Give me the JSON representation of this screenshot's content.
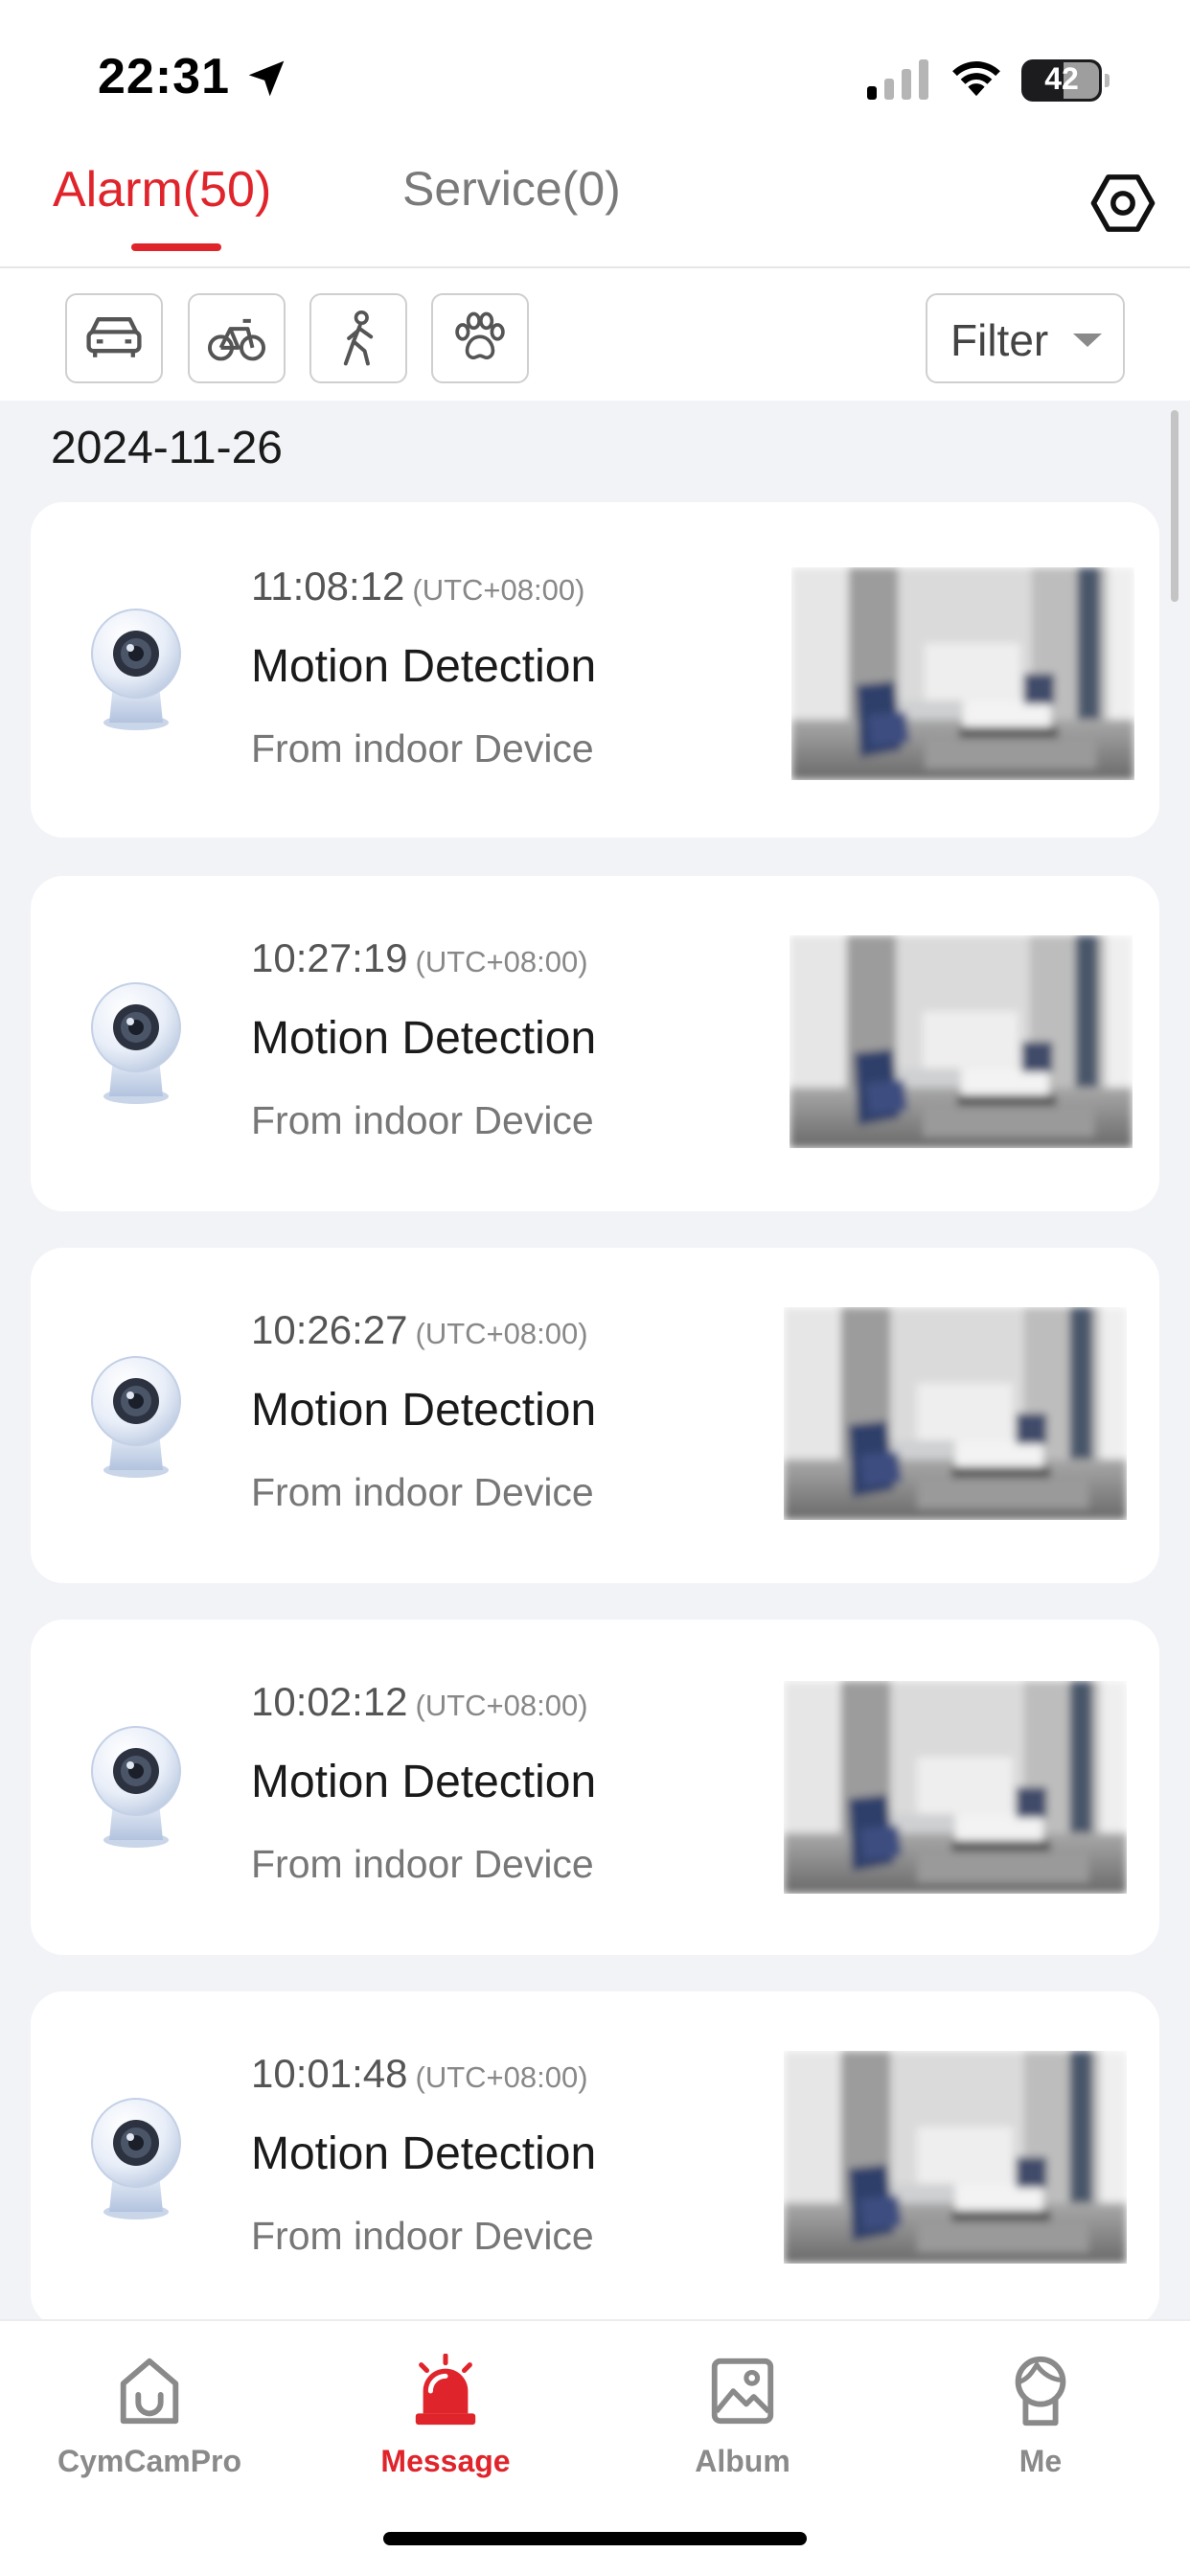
{
  "status_bar": {
    "time": "22:31",
    "battery": "42"
  },
  "tabs": {
    "alarm": "Alarm(50)",
    "service": "Service(0)"
  },
  "filters": {
    "categories": [
      "car-icon",
      "bicycle-icon",
      "person-walking-icon",
      "paw-icon"
    ],
    "filter_label": "Filter"
  },
  "list": {
    "date": "2024-11-26",
    "events": [
      {
        "time": "11:08:12",
        "timezone": "(UTC+08:00)",
        "title": "Motion Detection",
        "source": "From indoor Device"
      },
      {
        "time": "10:27:19",
        "timezone": "(UTC+08:00)",
        "title": "Motion Detection",
        "source": "From indoor Device"
      },
      {
        "time": "10:26:27",
        "timezone": "(UTC+08:00)",
        "title": "Motion Detection",
        "source": "From indoor Device"
      },
      {
        "time": "10:02:12",
        "timezone": "(UTC+08:00)",
        "title": "Motion Detection",
        "source": "From indoor Device"
      },
      {
        "time": "10:01:48",
        "timezone": "(UTC+08:00)",
        "title": "Motion Detection",
        "source": "From indoor Device"
      }
    ]
  },
  "bottom_nav": {
    "items": [
      {
        "label": "CymCamPro",
        "icon": "home-icon"
      },
      {
        "label": "Message",
        "icon": "alarm-bell-icon",
        "active": true
      },
      {
        "label": "Album",
        "icon": "image-icon"
      },
      {
        "label": "Me",
        "icon": "user-icon"
      }
    ]
  },
  "colors": {
    "accent": "#e0242b",
    "list_background": "#f2f3f7"
  }
}
